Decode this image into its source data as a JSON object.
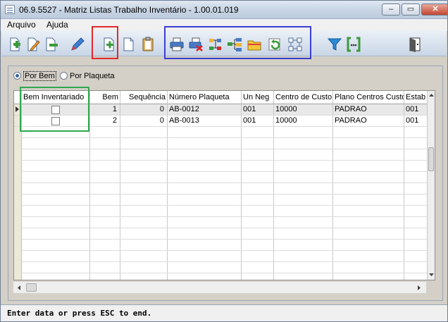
{
  "window": {
    "title": "06.9.5527 - Matriz Listas Trabalho Inventário - 1.00.01.019",
    "minimize_glyph": "–",
    "restore_glyph": "▭",
    "close_glyph": "✕"
  },
  "menu": {
    "items": [
      "Arquivo",
      "Ajuda"
    ]
  },
  "toolbar": {
    "icons": [
      "add-document-icon",
      "edit-document-icon",
      "remove-document-icon",
      "pencil-icon",
      "new-record-icon",
      "blank-page-icon",
      "clipboard-icon",
      "printer-icon",
      "delete-printer-icon",
      "tree-structure-icon",
      "hierarchy-icon",
      "folder-icon",
      "undo-icon",
      "network-icon",
      "filter-icon",
      "brackets-icon",
      "exit-door-icon"
    ],
    "highlight_colors": {
      "red": "#e3282c",
      "blue": "#3a3fd0",
      "green": "#2fa84f"
    }
  },
  "filter": {
    "options": [
      {
        "label": "Por Bem",
        "selected": true
      },
      {
        "label": "Por Plaqueta",
        "selected": false
      }
    ]
  },
  "grid": {
    "columns": [
      "Bem Inventariado",
      "Bem",
      "Sequência",
      "Número Plaqueta",
      "Un Neg",
      "Centro de Custo",
      "Plano Centros Custo",
      "Estab"
    ],
    "rows": [
      {
        "inventariado": false,
        "bem": "1",
        "sequencia": "0",
        "plaqueta": "AB-0012",
        "un_neg": "001",
        "centro_custo": "10000",
        "plano": "PADRAO",
        "estab": "001"
      },
      {
        "inventariado": false,
        "bem": "2",
        "sequencia": "0",
        "plaqueta": "AB-0013",
        "un_neg": "001",
        "centro_custo": "10000",
        "plano": "PADRAO",
        "estab": "001"
      }
    ]
  },
  "status_text": "Enter data or press ESC to end."
}
